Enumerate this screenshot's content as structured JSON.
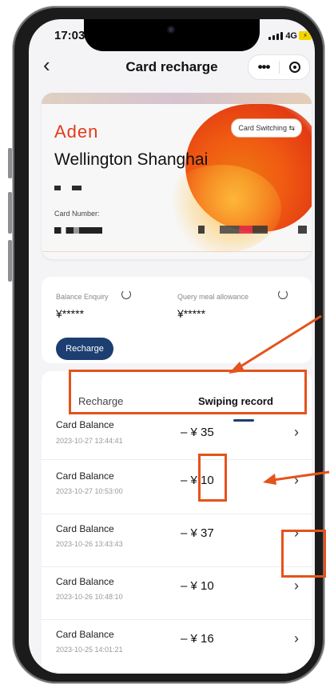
{
  "status_bar": {
    "time": "17:03",
    "network": "4G"
  },
  "nav": {
    "title": "Card recharge",
    "more": "•••"
  },
  "card": {
    "logo": "Aden",
    "name": "Wellington Shanghai",
    "switch_label": "Card Switching ⇆",
    "number_label": "Card Number:"
  },
  "balance": {
    "balance_label": "Balance Enquiry",
    "balance_value": "¥*****",
    "allowance_label": "Query meal allowance",
    "allowance_value": "¥*****",
    "recharge_button": "Recharge"
  },
  "tabs": {
    "recharge": "Recharge",
    "swiping": "Swiping record"
  },
  "records": [
    {
      "title": "Card Balance",
      "date": "2023-10-27 13:44:41",
      "amount": "– ¥ 35"
    },
    {
      "title": "Card Balance",
      "date": "2023-10-27 10:53:00",
      "amount": "– ¥ 10"
    },
    {
      "title": "Card Balance",
      "date": "2023-10-26 13:43:43",
      "amount": "– ¥ 37"
    },
    {
      "title": "Card Balance",
      "date": "2023-10-26 10:48:10",
      "amount": "– ¥ 10"
    },
    {
      "title": "Card Balance",
      "date": "2023-10-25 14:01:21",
      "amount": "– ¥ 16"
    }
  ],
  "colors": {
    "accent": "#1c3e70",
    "brand": "#e23a1c",
    "annotation": "#e4531c"
  }
}
